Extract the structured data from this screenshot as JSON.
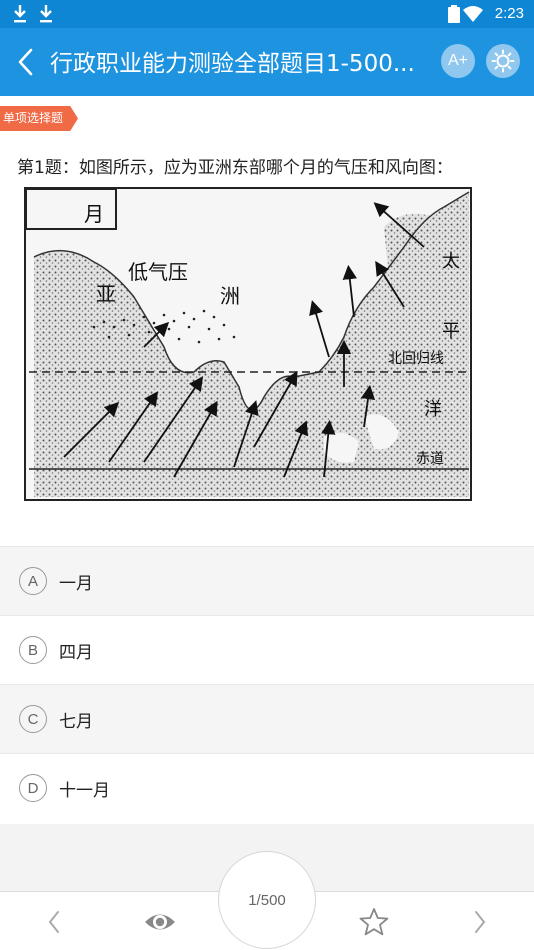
{
  "status_bar": {
    "time": "2:23"
  },
  "header": {
    "title": "行政职业能力测验全部题目1-500...",
    "font_button_label": "A+"
  },
  "question": {
    "type_tag": "单项选择题",
    "text": "第1题：如图所示，应为亚洲东部哪个月的气压和风向图：",
    "figure": {
      "month_label": "月",
      "low_pressure_label": "低气压",
      "asia_label_1": "亚",
      "asia_label_2": "洲",
      "ocean_label_1": "太",
      "ocean_label_2": "平",
      "ocean_label_3": "洋",
      "tropic_label": "北回归线",
      "equator_label": "赤道"
    }
  },
  "options": [
    {
      "letter": "A",
      "text": "一月"
    },
    {
      "letter": "B",
      "text": "四月"
    },
    {
      "letter": "C",
      "text": "七月"
    },
    {
      "letter": "D",
      "text": "十一月"
    }
  ],
  "pager": {
    "label": "1/500"
  },
  "colors": {
    "status_bar": "#0f86d4",
    "app_bar": "#1e93e0",
    "tag": "#ef6a45"
  }
}
